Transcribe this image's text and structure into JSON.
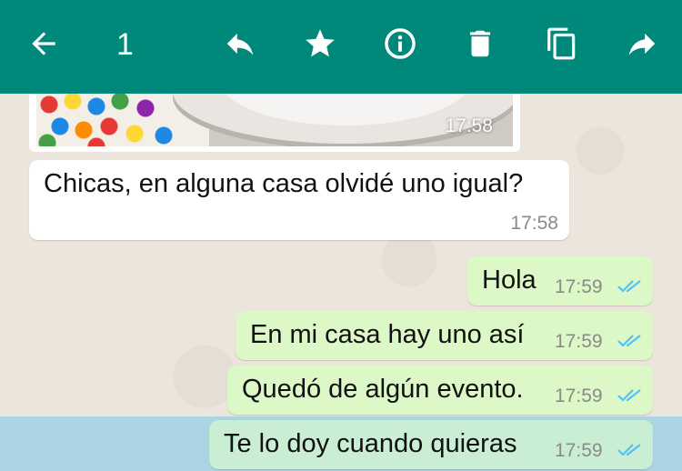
{
  "toolbar": {
    "selected_count": "1",
    "icons": [
      "back-arrow-icon",
      "reply-icon",
      "star-icon",
      "info-icon",
      "delete-icon",
      "copy-icon",
      "forward-icon"
    ],
    "accent": "#00897b"
  },
  "messages": [
    {
      "direction": "in",
      "type": "image",
      "time": "17:58"
    },
    {
      "direction": "in",
      "text": "Chicas, en alguna casa olvidé uno igual?",
      "time": "17:58"
    },
    {
      "direction": "out",
      "text": "Hola",
      "time": "17:59",
      "status": "read"
    },
    {
      "direction": "out",
      "text": "En mi casa hay uno así",
      "time": "17:59",
      "status": "read"
    },
    {
      "direction": "out",
      "text": "Quedó de algún evento.",
      "time": "17:59",
      "status": "read"
    },
    {
      "direction": "out",
      "text": "Te lo doy cuando quieras",
      "time": "17:59",
      "status": "read",
      "selected": true
    }
  ],
  "colors": {
    "incoming_bubble": "#ffffff",
    "outgoing_bubble": "#dcf8c6",
    "read_ticks": "#4fc3f7",
    "selection_highlight": "#34b7f1"
  }
}
